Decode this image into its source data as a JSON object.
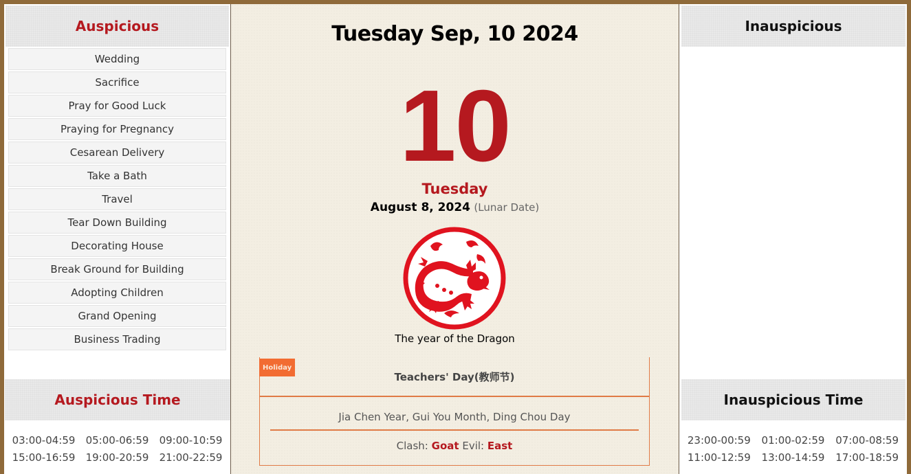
{
  "auspicious": {
    "title": "Auspicious",
    "items": [
      "Wedding",
      "Sacrifice",
      "Pray for Good Luck",
      "Praying for Pregnancy",
      "Cesarean Delivery",
      "Take a Bath",
      "Travel",
      "Tear Down Building",
      "Decorating House",
      "Break Ground for Building",
      "Adopting Children",
      "Grand Opening",
      "Business Trading"
    ]
  },
  "auspicious_time": {
    "title": "Auspicious Time",
    "slots": [
      "03:00-04:59",
      "05:00-06:59",
      "09:00-10:59",
      "15:00-16:59",
      "19:00-20:59",
      "21:00-22:59"
    ]
  },
  "inauspicious": {
    "title": "Inauspicious",
    "items": []
  },
  "inauspicious_time": {
    "title": "Inauspicious Time",
    "slots": [
      "23:00-00:59",
      "01:00-02:59",
      "07:00-08:59",
      "11:00-12:59",
      "13:00-14:59",
      "17:00-18:59"
    ]
  },
  "center": {
    "date_title": "Tuesday Sep, 10 2024",
    "day_number": "10",
    "weekday": "Tuesday",
    "lunar_date": "August 8, 2024",
    "lunar_note": "(Lunar Date)",
    "zodiac_icon": "dragon-papercut-icon",
    "zodiac_caption": "The year of the Dragon",
    "holiday_tag": "Holiday",
    "holiday_name": "Teachers' Day(教师节)",
    "ganzhi": "Jia Chen Year, Gui You Month, Ding Chou Day",
    "clash_label": "Clash:",
    "clash_value": "Goat",
    "evil_label": "Evil:",
    "evil_value": "East"
  },
  "colors": {
    "accent_red": "#b5191f",
    "frame_brown": "#8f6a3a",
    "holiday_orange": "#f26c32",
    "divider_orange": "#e07a45",
    "paper": "#f3eee2"
  }
}
